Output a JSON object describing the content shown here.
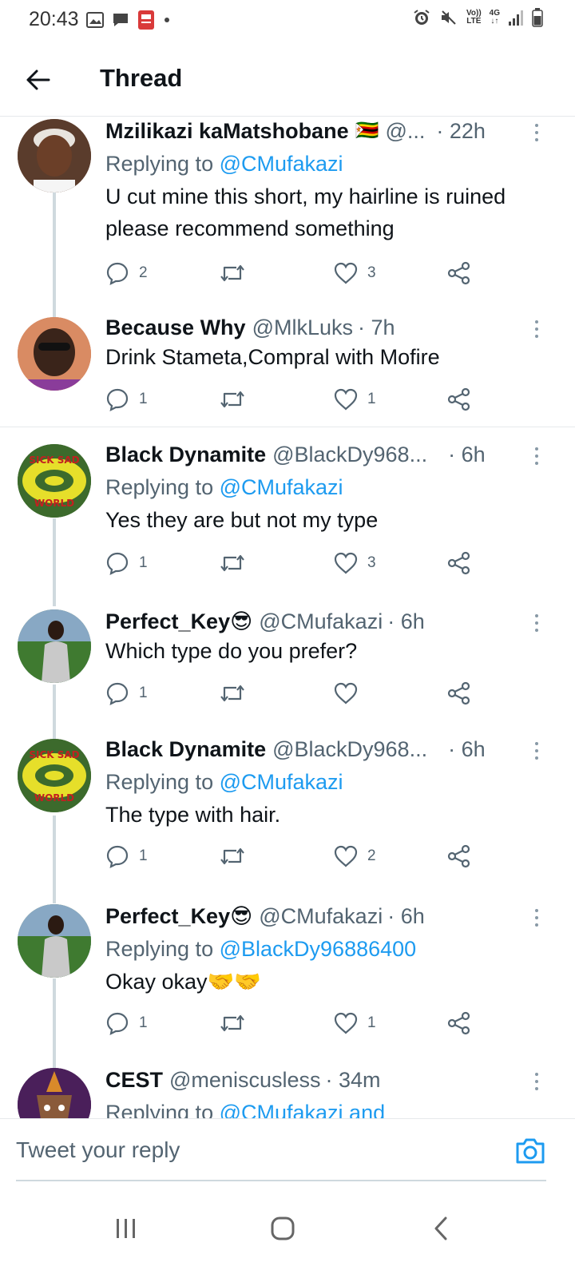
{
  "status_bar": {
    "time": "20:43",
    "left_icons": [
      "gallery-icon",
      "chat-icon",
      "pdf-icon",
      "dot-icon"
    ],
    "right_icons": [
      "alarm-icon",
      "mute-icon",
      "volte-icon",
      "network-4g-icon",
      "signal-icon",
      "battery-icon"
    ],
    "volte_line1": "Vo))",
    "volte_line2": "LTE",
    "net_line1": "4G",
    "net_line2": "↓↑"
  },
  "header": {
    "back_icon": "arrow-left-icon",
    "title": "Thread"
  },
  "tweets": [
    {
      "name": "Mzilikazi kaMatshobane",
      "flag": "🇿🇼",
      "handle": "@...",
      "time": "· 22h",
      "replying_prefix": "Replying to",
      "replying_to": "@CMufakazi",
      "text": "U cut mine this short, my hairline is ruined please recommend something",
      "replies": "2",
      "retweets": "",
      "likes": "3",
      "avatar_color": "#7a4a32"
    },
    {
      "name": "Because Why",
      "handle": "@MlkLuks",
      "time": "· 7h",
      "text": "Drink Stameta,Compral with Mofire",
      "replies": "1",
      "retweets": "",
      "likes": "1",
      "avatar_color": "#c4714a"
    },
    {
      "name": "Black Dynamite",
      "handle": "@BlackDy968...",
      "time": "· 6h",
      "replying_prefix": "Replying to",
      "replying_to": "@CMufakazi",
      "text": "Yes they are but not my type",
      "replies": "1",
      "retweets": "",
      "likes": "3",
      "avatar_text_top": "SICK SAD",
      "avatar_text_bottom": "WORLD"
    },
    {
      "name": "Perfect_Key😎",
      "handle": "@CMufakazi",
      "time": "· 6h",
      "text": "Which type do you prefer?",
      "replies": "1",
      "retweets": "",
      "likes": ""
    },
    {
      "name": "Black Dynamite",
      "handle": "@BlackDy968...",
      "time": "· 6h",
      "replying_prefix": "Replying to",
      "replying_to": "@CMufakazi",
      "text": "The type with hair.",
      "replies": "1",
      "retweets": "",
      "likes": "2",
      "avatar_text_top": "SICK SAD",
      "avatar_text_bottom": "WORLD"
    },
    {
      "name": "Perfect_Key😎",
      "handle": "@CMufakazi",
      "time": "· 6h",
      "replying_prefix": "Replying to",
      "replying_to": "@BlackDy96886400",
      "text": "Okay okay🤝🤝",
      "replies": "1",
      "retweets": "",
      "likes": "1"
    },
    {
      "name": "CEST",
      "handle": "@meniscusless",
      "time": "· 34m",
      "replying_prefix": "Replying to",
      "replying_to": "@CMufakazi and"
    }
  ],
  "composer": {
    "placeholder": "Tweet your reply",
    "camera_icon": "camera-icon"
  },
  "navbar": {
    "icons": [
      "recent-apps-icon",
      "home-icon",
      "back-icon"
    ]
  },
  "colors": {
    "accent": "#1d9bf0",
    "secondary_text": "#536471",
    "thread_line": "#cfd9de"
  }
}
